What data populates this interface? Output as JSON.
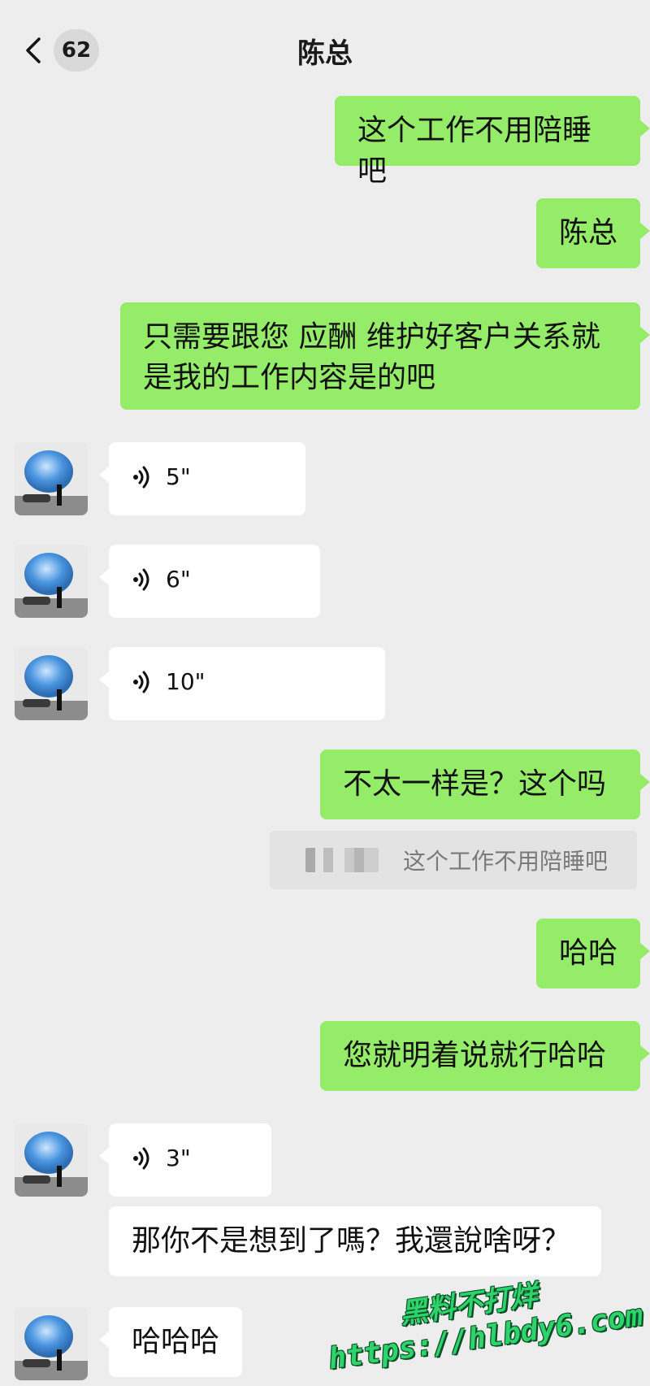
{
  "header": {
    "back_count": "62",
    "title": "陈总"
  },
  "messages": [
    {
      "type": "sent",
      "text": "这个工作不用陪睡吧"
    },
    {
      "type": "sent",
      "text": "陈总"
    },
    {
      "type": "sent",
      "text_line1": "只需要跟您 应酬 维护好客户关系就",
      "text_line2": "是我的工作内容是的吧"
    },
    {
      "type": "voice",
      "duration": "5\""
    },
    {
      "type": "voice",
      "duration": "6\""
    },
    {
      "type": "voice",
      "duration": "10\""
    },
    {
      "type": "sent",
      "text": "不太一样是？这个吗"
    },
    {
      "type": "quote",
      "text": "这个工作不用陪睡吧"
    },
    {
      "type": "sent",
      "text": "哈哈"
    },
    {
      "type": "sent",
      "text": "您就明着说就行哈哈"
    },
    {
      "type": "voice",
      "duration": "3\""
    },
    {
      "type": "received",
      "text": "那你不是想到了嗎？我還說啥呀？"
    },
    {
      "type": "received",
      "text": "哈哈哈"
    }
  ],
  "watermark": {
    "line1": "黑料不打烊",
    "line2": "https://hlbdy6.com"
  },
  "colors": {
    "background": "#ededed",
    "sent_bubble": "#95ec69",
    "received_bubble": "#ffffff",
    "watermark": "#2dd36b"
  }
}
